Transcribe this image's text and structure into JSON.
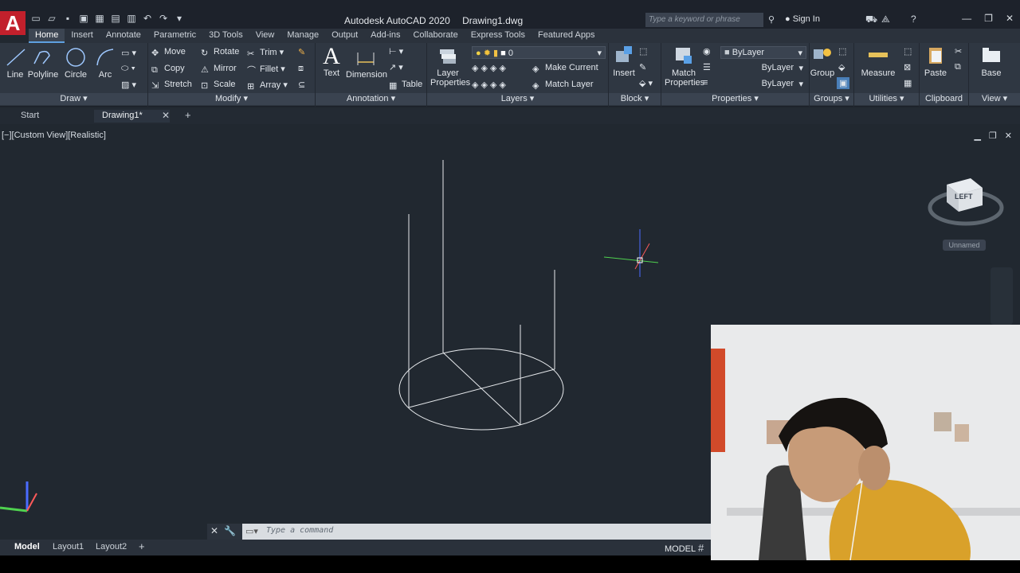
{
  "app": {
    "logo": "A",
    "title": "Autodesk AutoCAD 2020",
    "file": "Drawing1.dwg",
    "search_placeholder": "Type a keyword or phrase",
    "sign_in": "Sign In"
  },
  "tabs": [
    "Home",
    "Insert",
    "Annotate",
    "Parametric",
    "3D Tools",
    "View",
    "Manage",
    "Output",
    "Add-ins",
    "Collaborate",
    "Express Tools",
    "Featured Apps"
  ],
  "ribbon": {
    "draw": {
      "label": "Draw",
      "line": "Line",
      "polyline": "Polyline",
      "circle": "Circle",
      "arc": "Arc"
    },
    "modify": {
      "label": "Modify",
      "move": "Move",
      "rotate": "Rotate",
      "trim": "Trim",
      "copy": "Copy",
      "mirror": "Mirror",
      "fillet": "Fillet",
      "stretch": "Stretch",
      "scale": "Scale",
      "array": "Array"
    },
    "annotation": {
      "label": "Annotation",
      "text": "Text",
      "dimension": "Dimension",
      "table": "Table"
    },
    "layers": {
      "label": "Layers",
      "layer_properties_1": "Layer",
      "layer_properties_2": "Properties",
      "current_layer": "0",
      "make_current": "Make Current",
      "match_layer": "Match Layer"
    },
    "block": {
      "label": "Block",
      "insert": "Insert"
    },
    "properties": {
      "label": "Properties",
      "match_1": "Match",
      "match_2": "Properties",
      "bylayer_color": "ByLayer",
      "bylayer_linetype": "ByLayer",
      "bylayer_lineweight": "ByLayer"
    },
    "groups": {
      "label": "Groups",
      "group": "Group"
    },
    "utilities": {
      "label": "Utilities",
      "measure": "Measure"
    },
    "clipboard": {
      "label": "Clipboard",
      "paste": "Paste"
    },
    "view": {
      "label": "View",
      "base": "Base"
    }
  },
  "file_tabs": {
    "start": "Start",
    "drawing": "Drawing1*"
  },
  "viewport": {
    "label": "[−][Custom View][Realistic]",
    "viewcube_face": "LEFT",
    "viewcube_name": "Unnamed"
  },
  "command": {
    "placeholder": "Type a command"
  },
  "status": {
    "model": "Model",
    "layout1": "Layout1",
    "layout2": "Layout2",
    "model_btn": "MODEL"
  }
}
